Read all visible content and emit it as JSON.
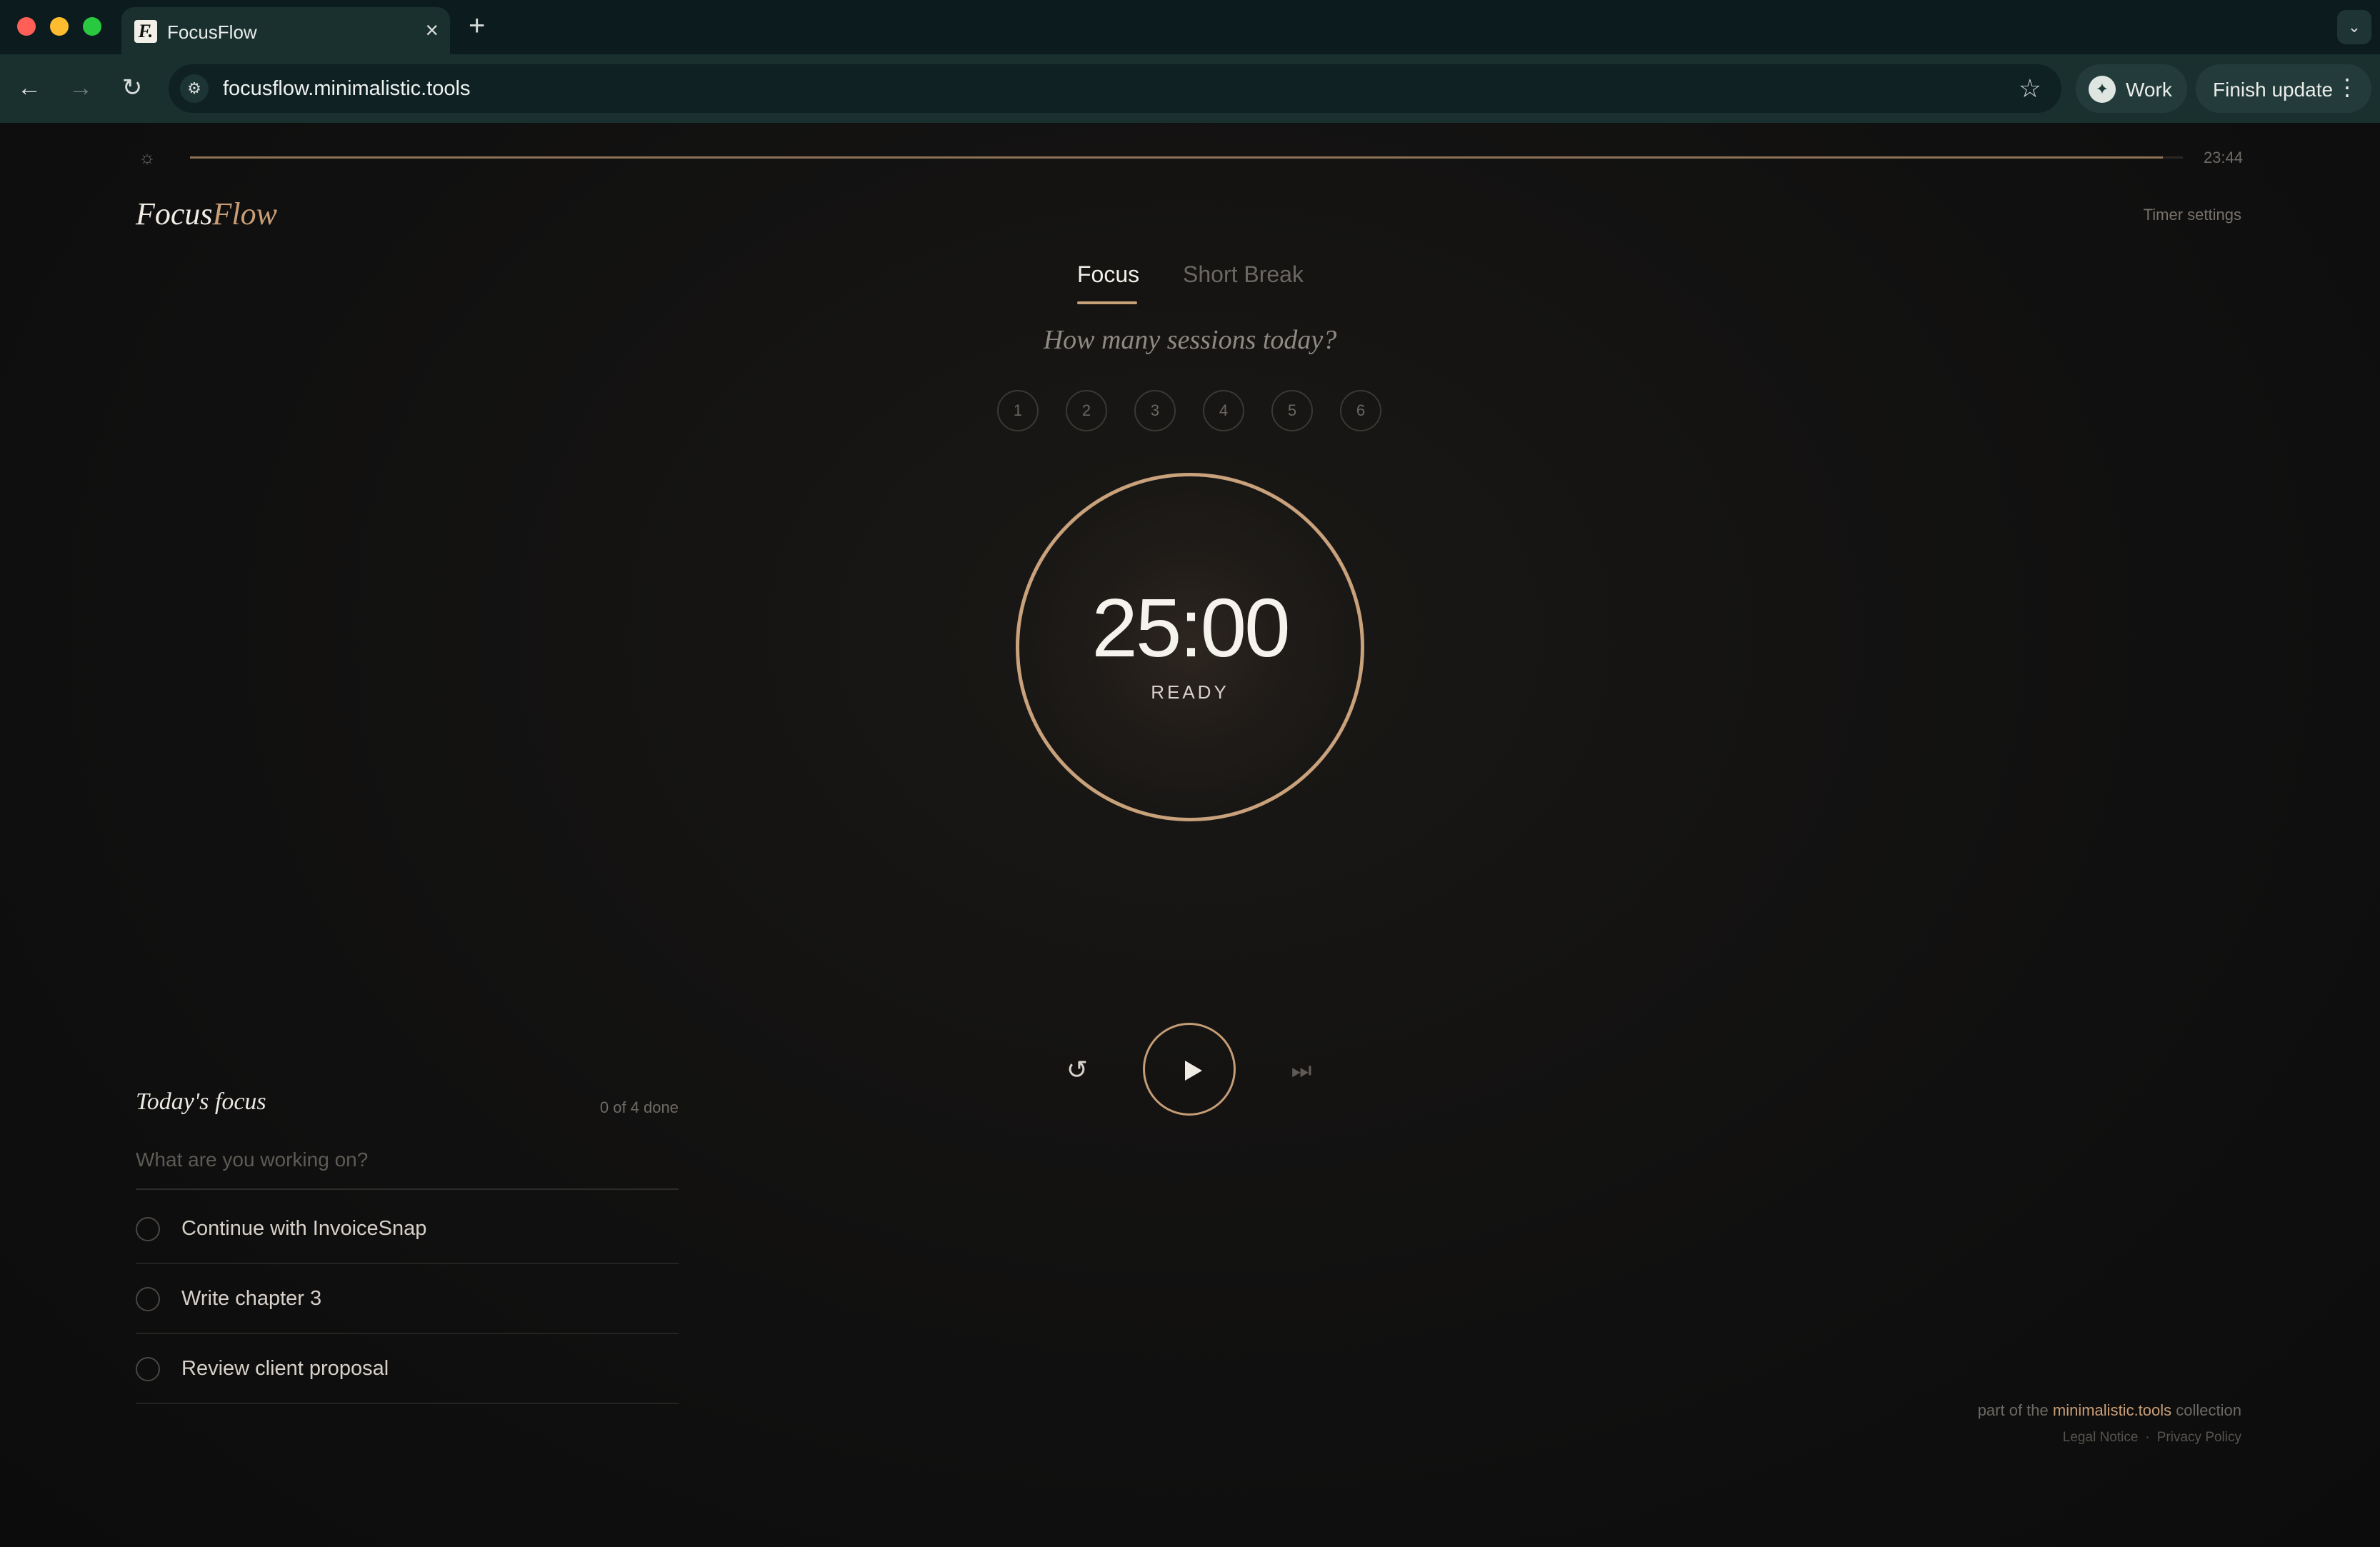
{
  "browser": {
    "tab_title": "FocusFlow",
    "tab_favicon_letter": "F.",
    "url": "focusflow.minimalistic.tools",
    "profile_label": "Work",
    "update_label": "Finish update"
  },
  "page": {
    "day_progress": 0.99,
    "clock": "23:44",
    "brand_part1": "Focus",
    "brand_part2": "Flow",
    "timer_settings": "Timer settings",
    "modes": [
      {
        "label": "Focus",
        "active": true
      },
      {
        "label": "Short Break",
        "active": false
      }
    ],
    "session_question": "How many sessions today?",
    "session_options": [
      "1",
      "2",
      "3",
      "4",
      "5",
      "6"
    ],
    "timer": {
      "time": "25:00",
      "status": "READY"
    }
  },
  "todos": {
    "title": "Today's focus",
    "count": "0 of 4 done",
    "input_placeholder": "What are you working on?",
    "items": [
      {
        "label": "Continue with InvoiceSnap",
        "done": false
      },
      {
        "label": "Write chapter 3",
        "done": false
      },
      {
        "label": "Review client proposal",
        "done": false
      }
    ]
  },
  "footer": {
    "prefix": "part of the",
    "link": "minimalistic.tools",
    "suffix": "collection",
    "legal": "Legal Notice",
    "separator": "·",
    "privacy": "Privacy Policy"
  },
  "colors": {
    "accent": "#c99e77",
    "background": "#121212",
    "chrome": "#19302f"
  },
  "icons": {
    "theme_toggle": "sun-icon",
    "reset": "reset-icon",
    "play": "play-icon",
    "skip": "skip-next-icon"
  }
}
